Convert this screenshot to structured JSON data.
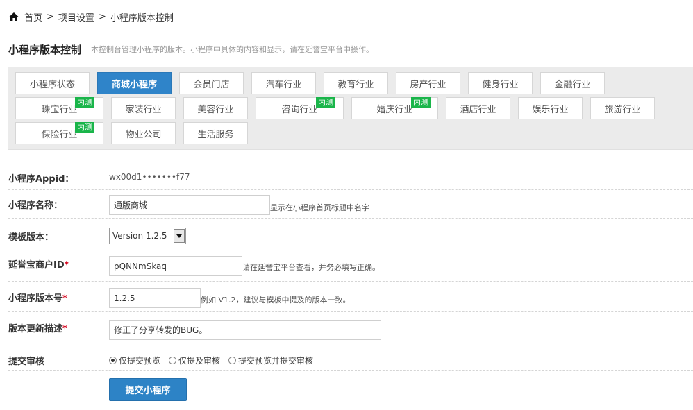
{
  "breadcrumb": {
    "items": [
      "首页",
      "项目设置",
      "小程序版本控制"
    ],
    "separator": ">"
  },
  "header": {
    "title": "小程序版本控制",
    "description": "本控制台管理小程序的版本。小程序中具体的内容和显示，请在延誉宝平台中操作。"
  },
  "tabs": [
    {
      "label": "小程序状态"
    },
    {
      "label": "商城小程序",
      "active": true
    },
    {
      "label": "会员门店"
    },
    {
      "label": "汽车行业"
    },
    {
      "label": "教育行业"
    },
    {
      "label": "房产行业"
    },
    {
      "label": "健身行业"
    },
    {
      "label": "金融行业"
    },
    {
      "label": "珠宝行业",
      "badge": "内测"
    },
    {
      "label": "家装行业"
    },
    {
      "label": "美容行业"
    },
    {
      "label": "咨询行业",
      "badge": "内测"
    },
    {
      "label": "婚庆行业",
      "badge": "内测"
    },
    {
      "label": "酒店行业"
    },
    {
      "label": "娱乐行业"
    },
    {
      "label": "旅游行业"
    },
    {
      "label": "保险行业",
      "badge": "内测"
    },
    {
      "label": "物业公司"
    },
    {
      "label": "生活服务"
    }
  ],
  "form": {
    "appid": {
      "label": "小程序Appid：",
      "value": "wx00d1•••••••f77"
    },
    "name": {
      "label": "小程序名称：",
      "value": "通版商城",
      "hint": "显示在小程序首页标题中名字"
    },
    "template": {
      "label": "模板版本：",
      "value": "Version 1.2.5"
    },
    "merchant_id": {
      "label": "延誉宝商户ID",
      "required": "*",
      "value": "pQNNmSkaq",
      "hint": "请在延誉宝平台查看，并务必填写正确。"
    },
    "version": {
      "label": "小程序版本号",
      "required": "*",
      "value": "1.2.5",
      "hint": "例如 V1.2，建议与模板中提及的版本一致。"
    },
    "description": {
      "label": "版本更新描述",
      "required": "*",
      "value": "修正了分享转发的BUG。"
    },
    "submit_review": {
      "label": "提交审核",
      "options": [
        {
          "label": "仅提交预览",
          "checked": true
        },
        {
          "label": "仅提及审核",
          "checked": false
        },
        {
          "label": "提交预览并提交审核",
          "checked": false
        }
      ]
    },
    "submit_button": "提交小程序"
  },
  "colors": {
    "accent": "#2f84c9",
    "badge": "#1ab54a",
    "required": "#d4001a"
  }
}
